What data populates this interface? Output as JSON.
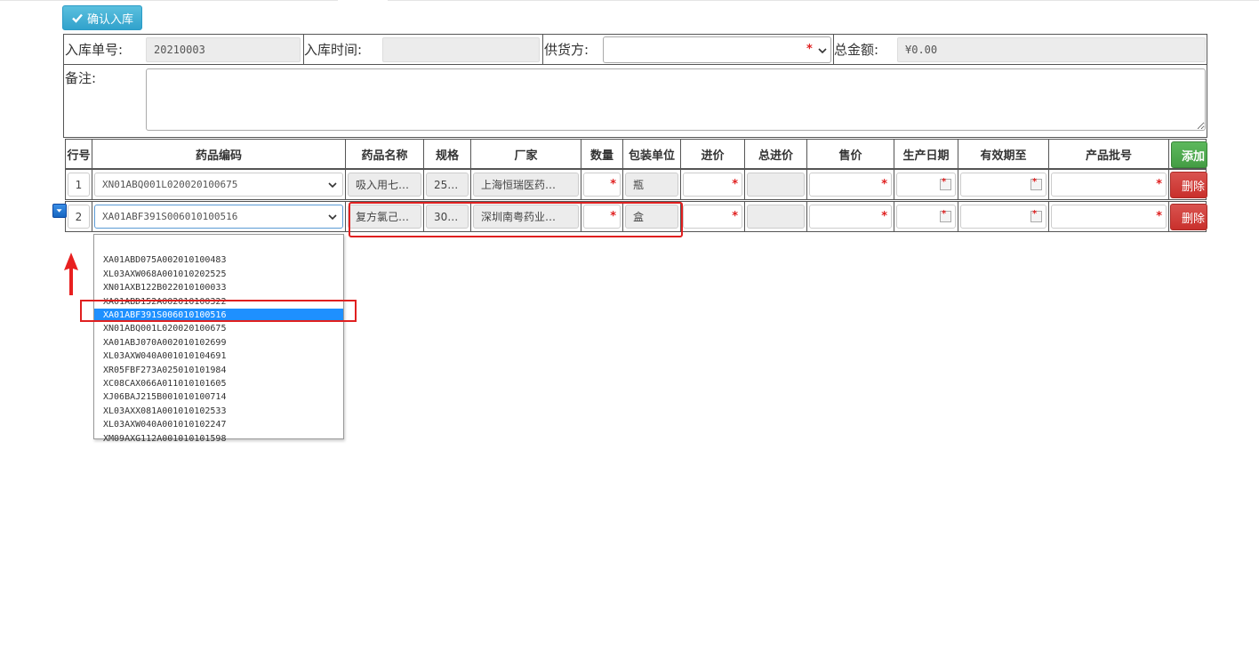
{
  "toolbar": {
    "confirm_label": "确认入库"
  },
  "form": {
    "order_no_label": "入库单号:",
    "order_no_value": "20210003",
    "time_label": "入库时间:",
    "time_value": "",
    "supplier_label": "供货方:",
    "supplier_value": "",
    "total_label": "总金额:",
    "total_value": "¥0.00",
    "remark_label": "备注:"
  },
  "grid": {
    "headers": [
      "行号",
      "药品编码",
      "药品名称",
      "规格",
      "厂家",
      "数量",
      "包装单位",
      "进价",
      "总进价",
      "售价",
      "生产日期",
      "有效期至",
      "产品批号"
    ],
    "add_label": "添加",
    "delete_label": "删除",
    "rows": [
      {
        "no": "1",
        "code": "XN01ABQ001L020020100675",
        "name": "吸入用七…",
        "spec": "25…",
        "maker": "上海恒瑞医药…",
        "unit": "瓶"
      },
      {
        "no": "2",
        "code": "XA01ABF391S006010100516",
        "name": "复方氯己…",
        "spec": "30…",
        "maker": "深圳南粤药业…",
        "unit": "盒"
      }
    ]
  },
  "dropdown": {
    "options": [
      "",
      "XA01ABD075A002010100483",
      "XL03AXW068A001010202525",
      "XN01AXB122B022010100033",
      "XA01ABD152A002010100322",
      "XA01ABF391S006010100516",
      "XN01ABQ001L020020100675",
      "XA01ABJ070A002010102699",
      "XL03AXW040A001010104691",
      "XR05FBF273A025010101984",
      "XC08CAX066A011010101605",
      "XJ06BAJ215B001010100714",
      "XL03AXX081A001010102533",
      "XL03AXW040A001010102247",
      "XM09AXG112A001010101598"
    ],
    "selected_index": 5
  },
  "required_mark": "*"
}
